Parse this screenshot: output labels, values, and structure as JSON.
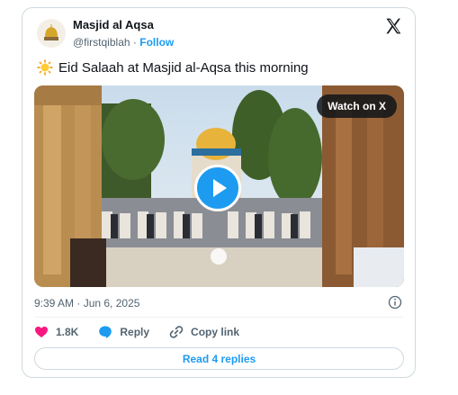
{
  "account": {
    "name": "Masjid al Aqsa",
    "handle": "@firstqiblah",
    "separator": "·",
    "follow_label": "Follow"
  },
  "tweet": {
    "text": "Eid Salaah at Masjid al-Aqsa this morning",
    "timestamp": "9:39 AM · Jun 6, 2025"
  },
  "media": {
    "watch_label": "Watch on X"
  },
  "actions": {
    "likes_count": "1.8K",
    "reply_label": "Reply",
    "copy_link_label": "Copy link"
  },
  "replies_button_label": "Read 4 replies",
  "icons": [
    "x-logo",
    "sun-emoji",
    "play-icon",
    "info-icon",
    "heart-icon",
    "reply-icon",
    "link-icon"
  ],
  "colors": {
    "accent": "#1d9bf0",
    "heart": "#f91880",
    "text_primary": "#0f1419",
    "text_secondary": "#536471",
    "border": "#cfd9de"
  }
}
